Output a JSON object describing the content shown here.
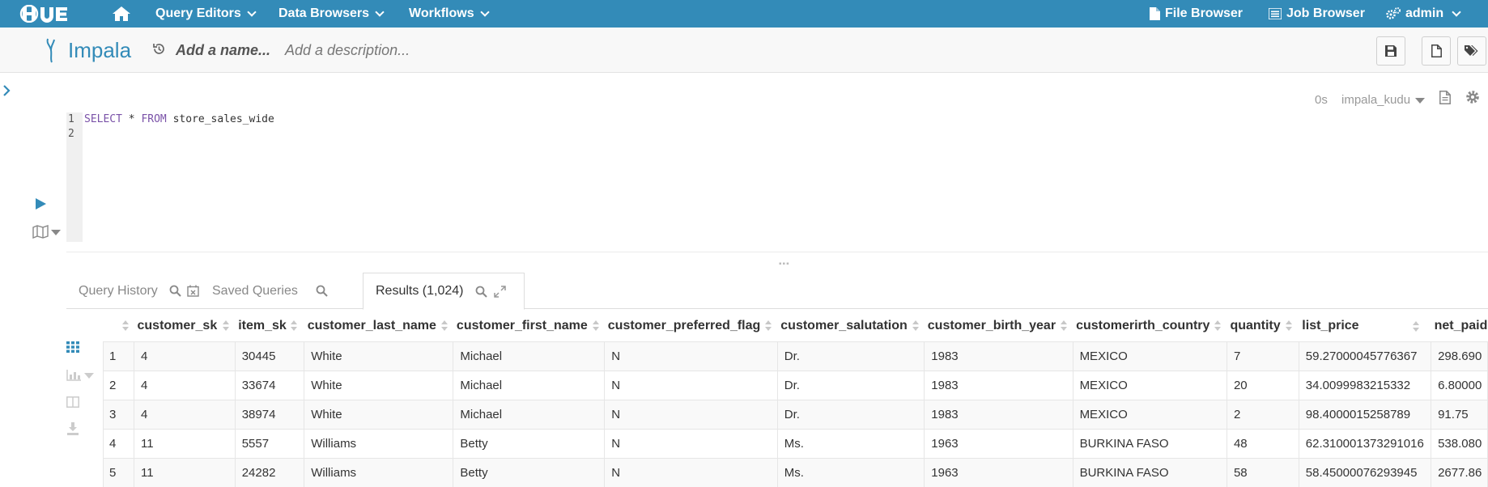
{
  "nav": {
    "logo": "HUE",
    "items": [
      {
        "label": "Query Editors"
      },
      {
        "label": "Data Browsers"
      },
      {
        "label": "Workflows"
      }
    ],
    "right": [
      {
        "label": "File Browser",
        "icon": "file-icon"
      },
      {
        "label": "Job Browser",
        "icon": "list-icon"
      },
      {
        "label": "admin",
        "icon": "cogs-icon"
      }
    ],
    "color": "#338bb8"
  },
  "editor": {
    "title": "Impala",
    "name_placeholder": "Add a name...",
    "desc_placeholder": "Add a description...",
    "exec_time": "0s",
    "database": "impala_kudu",
    "lines": [
      {
        "num": "1",
        "kw1": "SELECT",
        "mid": " * ",
        "kw2": "FROM",
        "rest": " store_sales_wide"
      },
      {
        "num": "2"
      }
    ]
  },
  "tabs": [
    {
      "label": "Query History"
    },
    {
      "label": "Saved Queries"
    },
    {
      "label": "Results (1,024)"
    }
  ],
  "results": {
    "columns": [
      "customer_sk",
      "item_sk",
      "customer_last_name",
      "customer_first_name",
      "customer_preferred_flag",
      "customer_salutation",
      "customer_birth_year",
      "customerirth_country",
      "quantity",
      "list_price",
      "net_paid"
    ],
    "rows": [
      [
        "1",
        "4",
        "30445",
        "White",
        "Michael",
        "N",
        "Dr.",
        "1983",
        "MEXICO",
        "7",
        "59.27000045776367",
        "298.690"
      ],
      [
        "2",
        "4",
        "33674",
        "White",
        "Michael",
        "N",
        "Dr.",
        "1983",
        "MEXICO",
        "20",
        "34.0099983215332",
        "6.80000"
      ],
      [
        "3",
        "4",
        "38974",
        "White",
        "Michael",
        "N",
        "Dr.",
        "1983",
        "MEXICO",
        "2",
        "98.4000015258789",
        "91.75"
      ],
      [
        "4",
        "11",
        "5557",
        "Williams",
        "Betty",
        "N",
        "Ms.",
        "1963",
        "BURKINA FASO",
        "48",
        "62.310001373291016",
        "538.080"
      ],
      [
        "5",
        "11",
        "24282",
        "Williams",
        "Betty",
        "N",
        "Ms.",
        "1963",
        "BURKINA FASO",
        "58",
        "58.45000076293945",
        "2677.86"
      ]
    ]
  }
}
